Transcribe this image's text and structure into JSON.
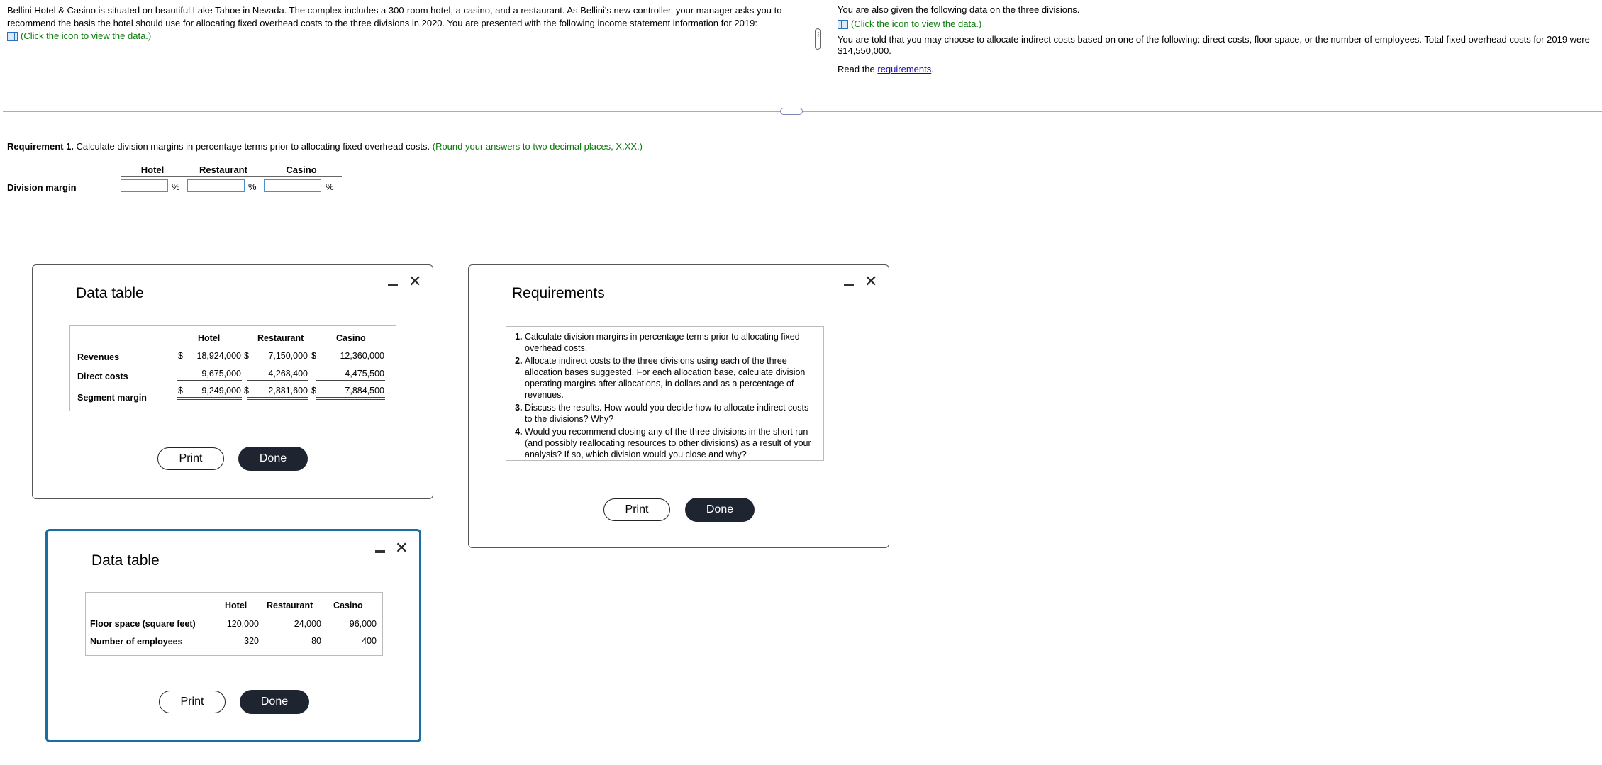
{
  "intro": {
    "text": "Bellini Hotel & Casino is situated on beautiful Lake Tahoe in Nevada. The complex includes a 300-room hotel, a casino, and a restaurant. As Bellini's new controller, your manager asks you to recommend the basis the hotel should use for allocating fixed overhead costs to the three divisions in 2020. You are presented with the following income statement information for 2019:",
    "icon_link": "(Click the icon to view the data.)"
  },
  "right_info": {
    "line1": "You are also given the following data on the three divisions.",
    "icon_link": "(Click the icon to view the data.)",
    "line2": "You are told that you may choose to allocate indirect costs based on one of the following: direct costs, floor space, or the number of employees. Total fixed overhead costs for 2019 were $14,550,000.",
    "read_prefix": "Read the ",
    "read_link": "requirements",
    "read_suffix": "."
  },
  "requirement1": {
    "label": "Requirement 1.",
    "text": " Calculate division margins in percentage terms prior to allocating fixed overhead costs.",
    "hint": " (Round your answers to two decimal places, X.XX.)",
    "columns": [
      "Hotel",
      "Restaurant",
      "Casino"
    ],
    "row_label": "Division margin",
    "unit": "%"
  },
  "dialog1": {
    "title": "Data table",
    "columns": [
      "Hotel",
      "Restaurant",
      "Casino"
    ],
    "rows": [
      {
        "label": "Revenues",
        "values": [
          "18,924,000",
          "7,150,000",
          "12,360,000"
        ]
      },
      {
        "label": "Direct costs",
        "values": [
          "9,675,000",
          "4,268,400",
          "4,475,500"
        ]
      },
      {
        "label": "Segment margin",
        "values": [
          "9,249,000",
          "2,881,600",
          "7,884,500"
        ]
      }
    ],
    "currency": "$",
    "print": "Print",
    "done": "Done"
  },
  "dialog2": {
    "title": "Data table",
    "columns": [
      "Hotel",
      "Restaurant",
      "Casino"
    ],
    "rows": [
      {
        "label": "Floor space (square feet)",
        "values": [
          "120,000",
          "24,000",
          "96,000"
        ]
      },
      {
        "label": "Number of employees",
        "values": [
          "320",
          "80",
          "400"
        ]
      }
    ],
    "print": "Print",
    "done": "Done"
  },
  "requirements_dialog": {
    "title": "Requirements",
    "items": [
      "Calculate division margins in percentage terms prior to allocating fixed overhead costs.",
      "Allocate indirect costs to the three divisions using each of the three allocation bases suggested. For each allocation base, calculate division operating margins after allocations, in dollars and as a percentage of revenues.",
      "Discuss the results. How would you decide how to allocate indirect costs to the divisions? Why?",
      "Would you recommend closing any of the three divisions in the short run (and possibly reallocating resources to other divisions) as a result of your analysis? If so, which division would you close and why?"
    ],
    "print": "Print",
    "done": "Done"
  },
  "icons": {
    "data_icon": "table-grid-icon",
    "minimize": "minimize-icon",
    "close": "close-icon"
  },
  "colors": {
    "hint_green": "#0a7a0a",
    "input_border": "#4a8fd1",
    "done_bg": "#1e2430",
    "focus_border": "#1b6ea0"
  }
}
